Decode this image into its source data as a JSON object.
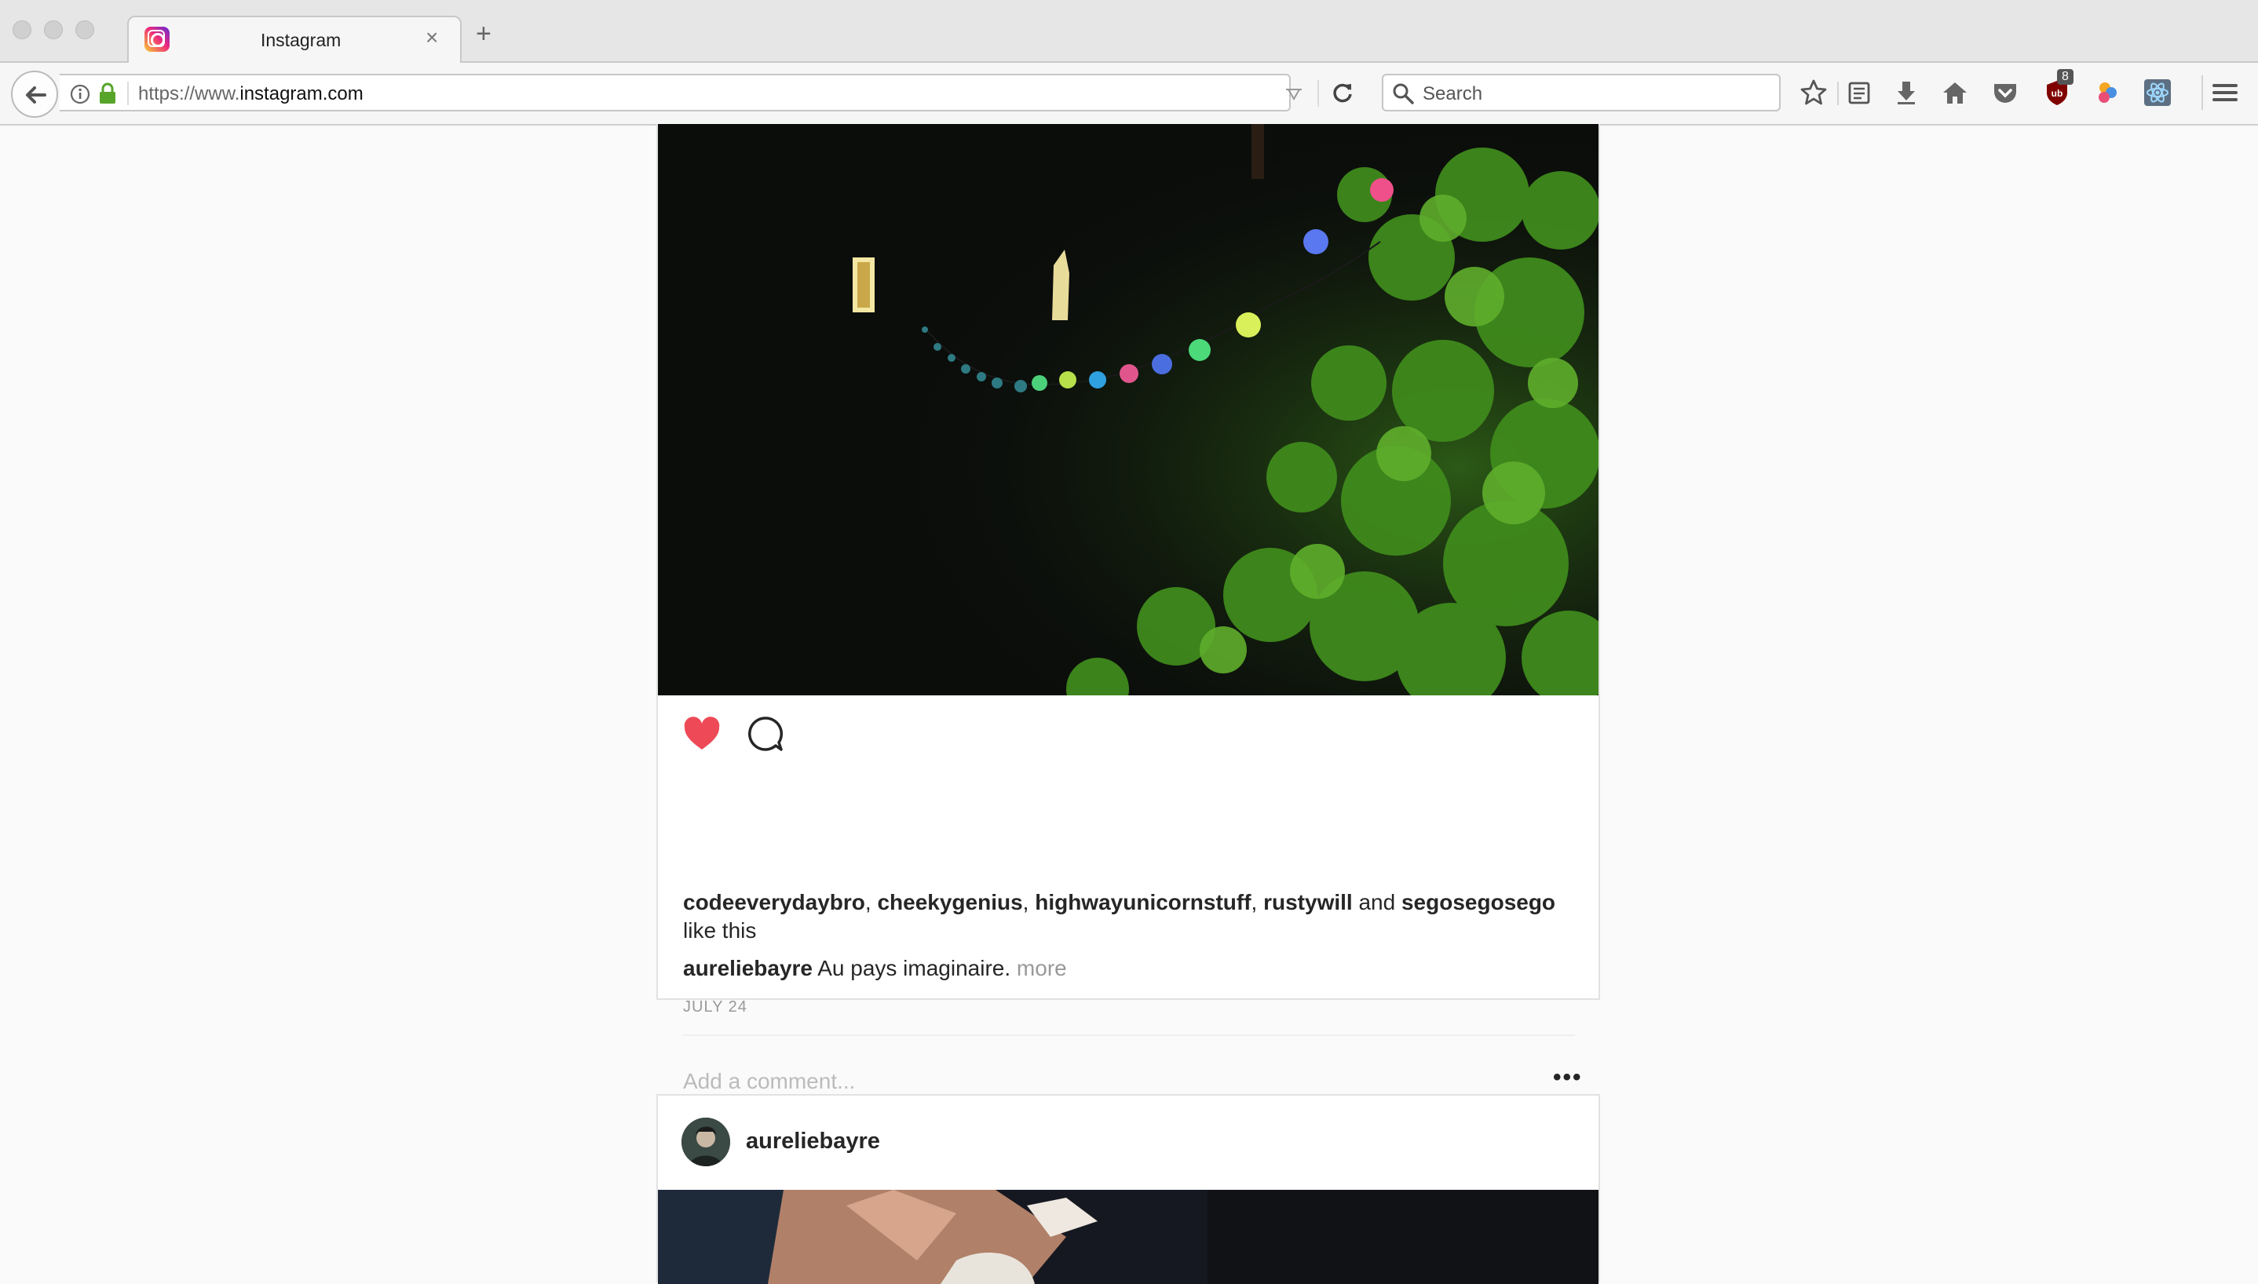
{
  "browser": {
    "tab_title": "Instagram",
    "tab_close": "×",
    "new_tab": "+",
    "url_prefix": "https://www.",
    "url_domain": "instagram.com",
    "search_placeholder": "Search",
    "ublock_badge": "8"
  },
  "post1": {
    "liked": true,
    "likers": [
      "codeeverydaybro",
      "cheekygenius",
      "highwayunicornstuff",
      "rustywill",
      "segosegosego"
    ],
    "likes_sep1": ", ",
    "likes_and": " and ",
    "likes_suffix": "like this",
    "caption_user": "aureliebayre",
    "caption_text": "Au pays imaginaire.",
    "caption_more": "more",
    "date": "JULY 24",
    "comment_placeholder": "Add a comment...",
    "more_options": "•••"
  },
  "post2": {
    "username": "aureliebayre"
  },
  "colors": {
    "heart": "#ed4956",
    "ublock": "#800000",
    "secure_lock": "#57a42a"
  }
}
